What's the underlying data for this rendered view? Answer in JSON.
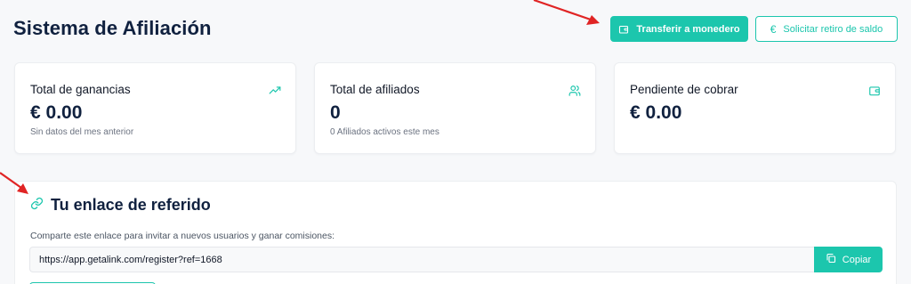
{
  "header": {
    "title": "Sistema de Afiliación",
    "transfer_button": "Transferir a monedero",
    "withdraw_button": "Solicitar retiro de saldo"
  },
  "cards": [
    {
      "label": "Total de ganancias",
      "value": "€ 0.00",
      "sub": "Sin datos del mes anterior",
      "icon": "trending-up-icon"
    },
    {
      "label": "Total de afiliados",
      "value": "0",
      "sub": "0 Afiliados activos este mes",
      "icon": "users-icon"
    },
    {
      "label": "Pendiente de cobrar",
      "value": "€ 0.00",
      "sub": "",
      "icon": "wallet-icon"
    }
  ],
  "referral": {
    "title": "Tu enlace de referido",
    "description": "Comparte este enlace para invitar a nuevos usuarios y ganar comisiones:",
    "link": "https://app.getalink.com/register?ref=1668",
    "copy_label": "Copiar"
  },
  "colors": {
    "accent": "#1cc6ad",
    "title": "#10213f",
    "annotation": "#e02424"
  }
}
